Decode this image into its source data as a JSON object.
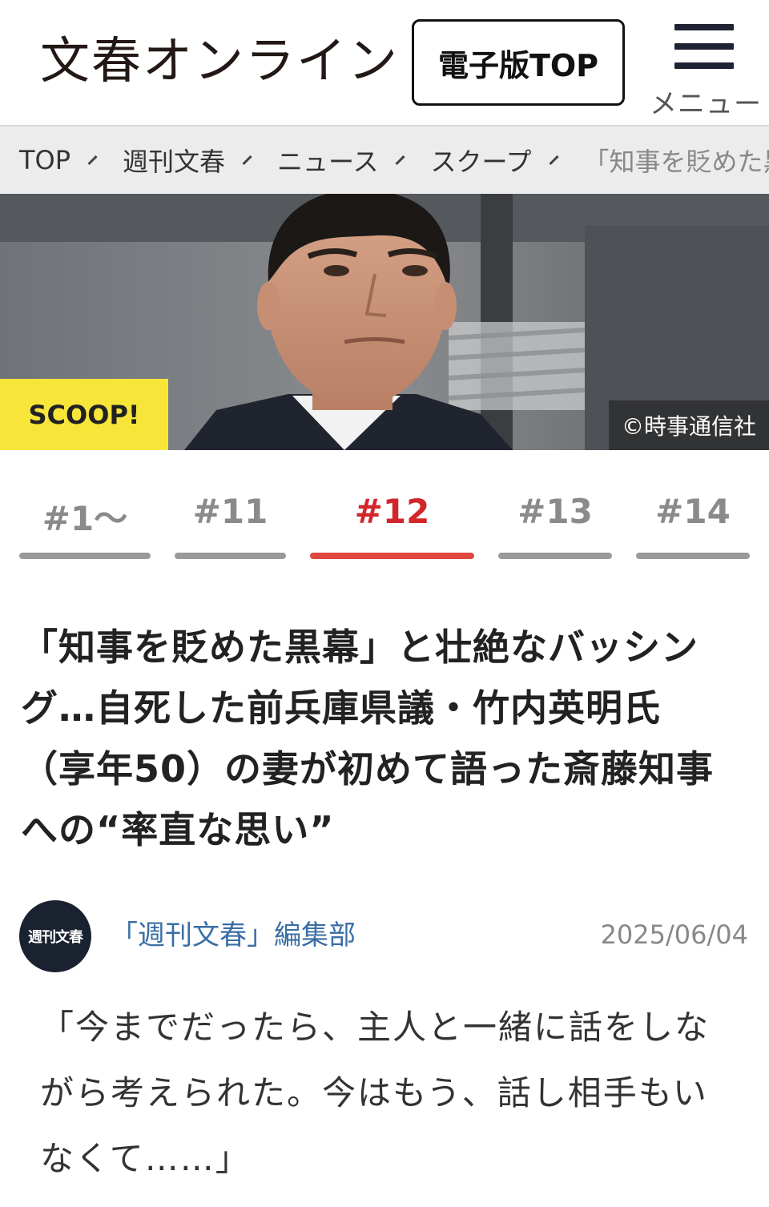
{
  "header": {
    "logo": "文春オンライン",
    "edition_button": "電子版TOP",
    "menu_label": "メニュー"
  },
  "breadcrumb": {
    "items": [
      {
        "label": "TOP"
      },
      {
        "label": "週刊文春"
      },
      {
        "label": "ニュース"
      },
      {
        "label": "スクープ"
      },
      {
        "label": "「知事を貶めた黒"
      }
    ]
  },
  "hero": {
    "badge": "SCOOP!",
    "credit": "©時事通信社"
  },
  "tabs": [
    {
      "label": "#1〜",
      "active": false
    },
    {
      "label": "#11",
      "active": false
    },
    {
      "label": "#12",
      "active": true
    },
    {
      "label": "#13",
      "active": false
    },
    {
      "label": "#14",
      "active": false
    }
  ],
  "article": {
    "title": "「知事を貶めた黒幕」と壮絶なバッシング…自死した前兵庫県議・竹内英明氏（享年50）の妻が初めて語った斎藤知事への“率直な思い”",
    "author": "「週刊文春」編集部",
    "avatar_text": "週刊文春",
    "date": "2025/06/04",
    "body": "「今までだったら、主人と一緒に話をしながら考えられた。今はもう、話し相手もいなくて……」"
  },
  "colors": {
    "accent_red": "#d1272b",
    "scoop_yellow": "#f7e53a",
    "author_link": "#3a6ea5"
  }
}
